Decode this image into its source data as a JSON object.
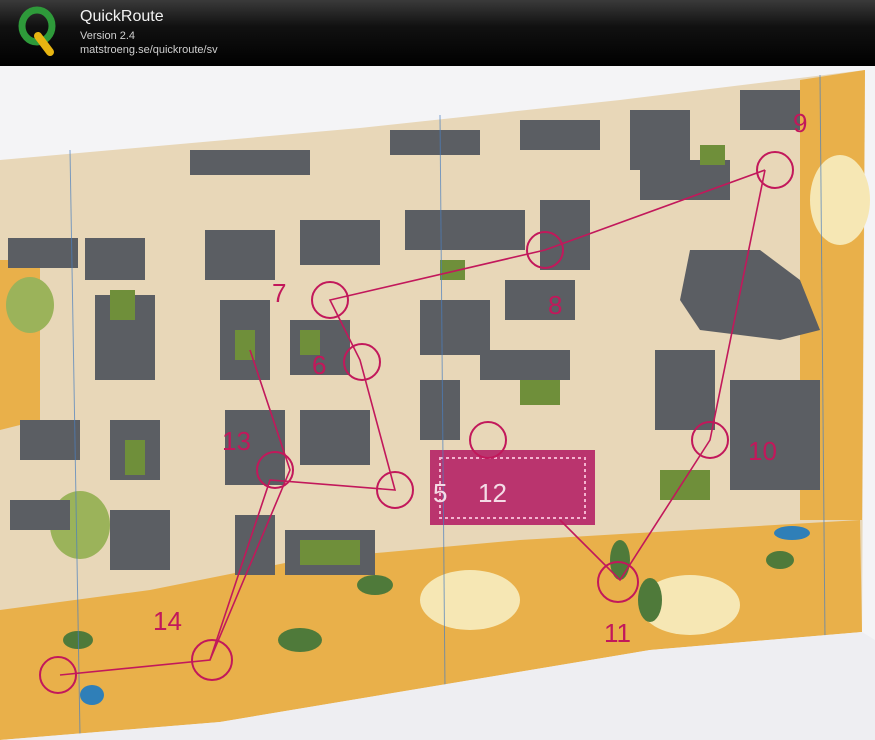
{
  "header": {
    "app_name": "QuickRoute",
    "version": "Version 2.4",
    "url": "matstroeng.se/quickroute/sv",
    "logo_letter": "Q",
    "logo_icon": "quickroute-q-logo"
  },
  "map": {
    "control_numbers": [
      "5",
      "6",
      "7",
      "8",
      "9",
      "10",
      "11",
      "12",
      "13",
      "14"
    ],
    "colors": {
      "open_land": "#e9b04a",
      "paved": "#e8d7b8",
      "building": "#5b5e63",
      "green": "#6f8f3a",
      "course": "#c2185b",
      "water_blue": "#2f7fb8"
    }
  }
}
